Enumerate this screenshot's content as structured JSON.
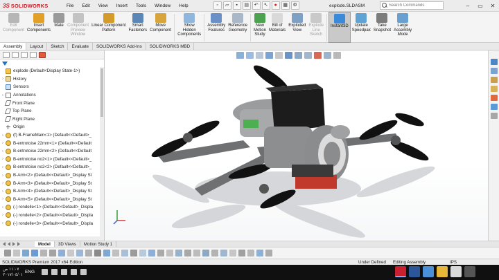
{
  "app": {
    "brand": "SOLIDWORKS",
    "document_title": "explode.SLDASM",
    "window_controls": [
      "–",
      "▭",
      "✕"
    ]
  },
  "menu": [
    "File",
    "Edit",
    "View",
    "Insert",
    "Tools",
    "Window",
    "Help"
  ],
  "search": {
    "placeholder": "Search Commands"
  },
  "ribbon": [
    {
      "label": "Edit\nComponent",
      "disabled": true,
      "color": "#b6b6b6"
    },
    {
      "label": "Insert\nComponents",
      "disabled": false,
      "color": "#e2a126"
    },
    {
      "label": "Mate",
      "disabled": false,
      "color": "#9a9a9a"
    },
    {
      "label": "Component\nPreview\nWindow",
      "disabled": true,
      "color": "#c3c3c3"
    },
    {
      "label": "Linear Component\nPattern",
      "disabled": false,
      "color": "#d49a2a"
    },
    {
      "label": "Smart\nFasteners",
      "disabled": false,
      "color": "#5a86b8"
    },
    {
      "label": "Move\nComponent",
      "disabled": false,
      "color": "#d7a53a"
    },
    {
      "label": "Show\nHidden\nComponents",
      "disabled": false,
      "color": "#8fb7dd"
    },
    {
      "label": "Assembly\nFeatures",
      "disabled": false,
      "color": "#6b8fc7"
    },
    {
      "label": "Reference\nGeometry",
      "disabled": false,
      "color": "#a9b7c9"
    },
    {
      "label": "New\nMotion\nStudy",
      "disabled": false,
      "color": "#4ba24f"
    },
    {
      "label": "Bill of\nMaterials",
      "disabled": false,
      "color": "#d9d9d9"
    },
    {
      "label": "Exploded\nView",
      "disabled": false,
      "color": "#7da0c4"
    },
    {
      "label": "Explode\nLine\nSketch",
      "disabled": true,
      "color": "#c9c9c9"
    },
    {
      "label": "Instant3D",
      "disabled": false,
      "color": "#3b8ad9",
      "active": true
    },
    {
      "label": "Update\nSpeedpak",
      "disabled": false,
      "color": "#5fa3d4"
    },
    {
      "label": "Take\nSnapshot",
      "disabled": false,
      "color": "#7c7c7c"
    },
    {
      "label": "Large\nAssembly\nMode",
      "disabled": false,
      "color": "#6aa0d0"
    }
  ],
  "command_tabs": [
    "Assembly",
    "Layout",
    "Sketch",
    "Evaluate",
    "SOLIDWORKS Add-Ins",
    "SOLIDWORKS MBD"
  ],
  "tree": [
    {
      "label": "explode  (Default<Display State-1>)",
      "icon": "doc",
      "exp": ""
    },
    {
      "label": "History",
      "icon": "folder",
      "exp": "›"
    },
    {
      "label": "Sensors",
      "icon": "sensor",
      "exp": ""
    },
    {
      "label": "Annotations",
      "icon": "annot",
      "exp": "›"
    },
    {
      "label": "Front Plane",
      "icon": "plane",
      "exp": ""
    },
    {
      "label": "Top Plane",
      "icon": "plane",
      "exp": ""
    },
    {
      "label": "Right Plane",
      "icon": "plane",
      "exp": ""
    },
    {
      "label": "Origin",
      "icon": "origin",
      "exp": ""
    },
    {
      "label": "(f) B-FrameMain<1> (Default<<Default>_",
      "icon": "part",
      "exp": "›"
    },
    {
      "label": "B-entrotoise 22mm<1> (Default<<Default",
      "icon": "part",
      "exp": "›"
    },
    {
      "label": "B-entrotoise 22mm<2> (Default<<Default",
      "icon": "part",
      "exp": "›"
    },
    {
      "label": "B-entrotoise no2<1> (Default<<Default>_",
      "icon": "part",
      "exp": "›"
    },
    {
      "label": "B-entrotoise no2<2> (Default<<Default>_",
      "icon": "part",
      "exp": "›"
    },
    {
      "label": "B-Arm<2> (Default<<Default>_Display St",
      "icon": "part",
      "exp": "›"
    },
    {
      "label": "B-Arm<3> (Default<<Default>_Display St",
      "icon": "part",
      "exp": "›"
    },
    {
      "label": "B-Arm<4> (Default<<Default>_Display St",
      "icon": "part",
      "exp": "›"
    },
    {
      "label": "B-Arm<5> (Default<<Default>_Display St",
      "icon": "part",
      "exp": "›"
    },
    {
      "label": "(-) rondelle<1> (Default<<Default>_Displa",
      "icon": "part",
      "exp": "›"
    },
    {
      "label": "(-) rondelle<2> (Default<<Default>_Displa",
      "icon": "part",
      "exp": "›"
    },
    {
      "label": "(-) rondelle<3> (Default<<Default>_Displa",
      "icon": "part",
      "exp": "›"
    }
  ],
  "model_tabs": [
    "Model",
    "3D Views",
    "Motion Study 1"
  ],
  "status": {
    "edition": "SOLIDWORKS Premium 2017 x64 Edition",
    "defined": "Under Defined",
    "mode": "Editing Assembly",
    "units": "IPS"
  },
  "taskbar": {
    "time": "١١:٠٧ ص",
    "date": "٢٠١٧/٠٤/٠١",
    "language": "ENG"
  }
}
